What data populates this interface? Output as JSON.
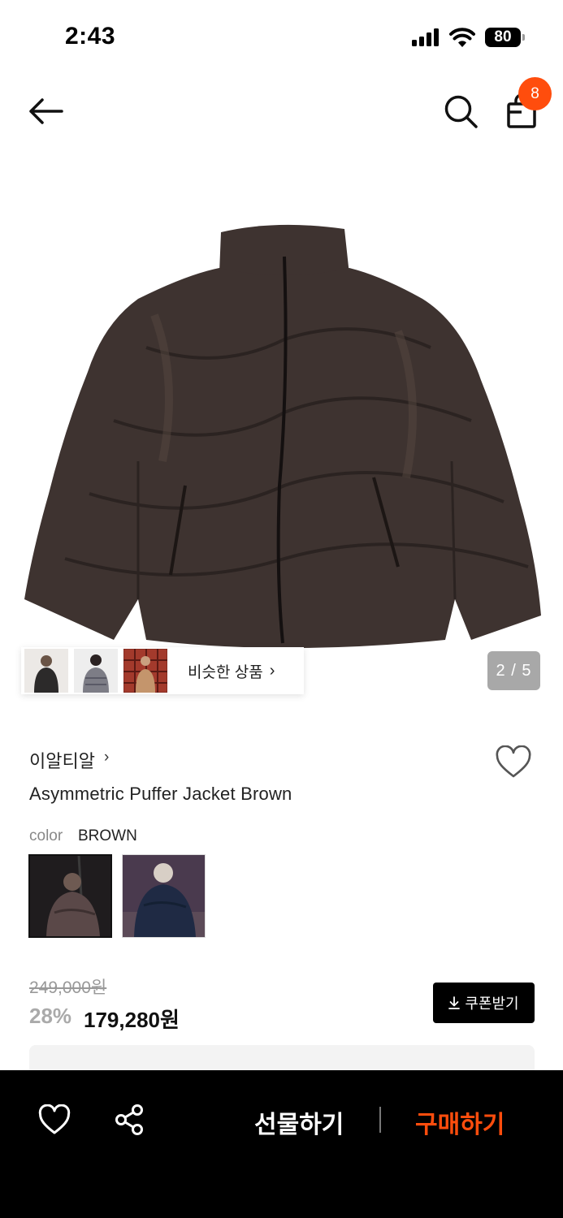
{
  "status_bar": {
    "time": "2:43",
    "battery": "80"
  },
  "nav": {
    "cart_count": "8"
  },
  "gallery": {
    "similar_label": "비슷한 상품",
    "similar_chevron": "›",
    "page_indicator": "2 / 5"
  },
  "product": {
    "brand": "이알티알",
    "brand_chevron": "›",
    "name": "Asymmetric Puffer Jacket Brown",
    "color_label": "color",
    "color_value": "BROWN"
  },
  "price": {
    "original": "249,000원",
    "discount": "28%",
    "sale": "179,280원",
    "coupon_label": "쿠폰받기"
  },
  "bottom_bar": {
    "gift_label": "선물하기",
    "buy_label": "구매하기"
  },
  "colors": {
    "accent": "#ff4d0d",
    "jacket": "#3e3330"
  }
}
